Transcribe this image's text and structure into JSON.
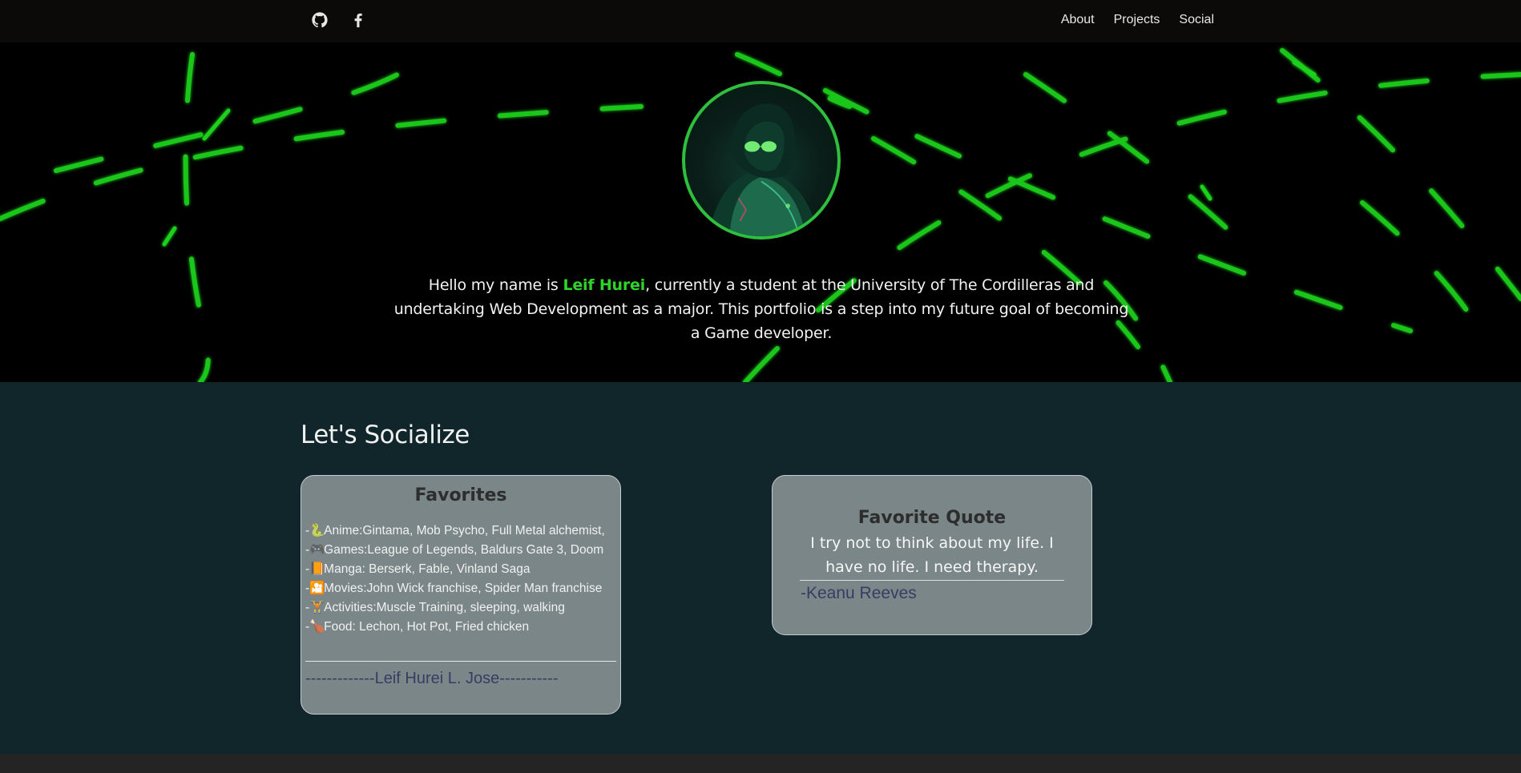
{
  "nav": {
    "icons": [
      "github-icon",
      "facebook-icon"
    ],
    "links": [
      "About",
      "Projects",
      "Social"
    ]
  },
  "hero": {
    "intro_before": "Hello my name is ",
    "intro_name": "Leif Hurei",
    "intro_after": ", currently a student at the University of The Cordilleras and undertaking Web Development as a major. This portfolio is a step into my future goal of becoming a Game developer.",
    "accent_color": "#2fd42a"
  },
  "social": {
    "title": "Let's Socialize",
    "favorites": {
      "title": "Favorites",
      "items": [
        {
          "icon": "🐍",
          "text": "Anime:Gintama, Mob Psycho, Full Metal alchemist,"
        },
        {
          "icon": "🎮",
          "text": "Games:League of Legends, Baldurs Gate 3, Doom"
        },
        {
          "icon": "📙",
          "text": "Manga: Berserk, Fable, Vinland Saga"
        },
        {
          "icon": "🎦",
          "text": "Movies:John Wick franchise, Spider Man franchise"
        },
        {
          "icon": "🏋",
          "text": "Activities:Muscle Training, sleeping, walking"
        },
        {
          "icon": "🍗",
          "text": "Food: Lechon, Hot Pot, Fried chicken"
        }
      ],
      "signature": "-------------Leif Hurei L. Jose-----------"
    },
    "quote": {
      "title": "Favorite Quote",
      "text": "I try not to think about my life. I have no life. I need therapy.",
      "author": "-Keanu Reeves"
    }
  }
}
